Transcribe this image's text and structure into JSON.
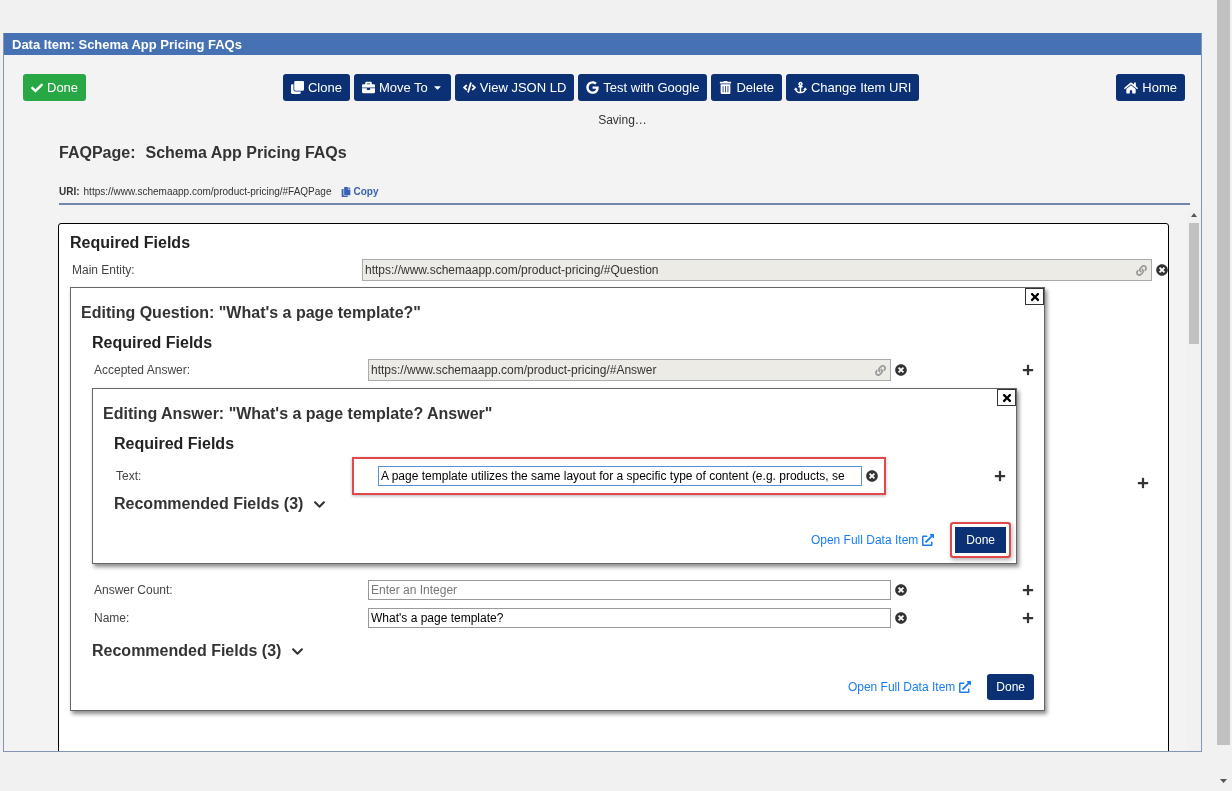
{
  "panel": {
    "title": "Data Item: Schema App Pricing FAQs"
  },
  "toolbar": {
    "done": {
      "label": "Done"
    },
    "actions": [
      {
        "label": "Clone",
        "kind": "clone",
        "dropdown": false
      },
      {
        "label": "Move To",
        "kind": "move",
        "dropdown": true
      },
      {
        "label": "View JSON LD",
        "kind": "code",
        "dropdown": false
      },
      {
        "label": "Test with Google",
        "kind": "google",
        "dropdown": false
      },
      {
        "label": "Delete",
        "kind": "delete",
        "dropdown": false
      },
      {
        "label": "Change Item URI",
        "kind": "anchor",
        "dropdown": false
      }
    ],
    "home": {
      "label": "Home"
    }
  },
  "status": "Saving…",
  "item": {
    "type": "FAQPage:",
    "name": "Schema App Pricing FAQs",
    "uri_label": "URI:",
    "uri": "https://www.schemaapp.com/product-pricing/#FAQPage",
    "copy": "Copy"
  },
  "main_form": {
    "section": "Required Fields",
    "fields": [
      {
        "label": "Main Entity:",
        "value": "https://www.schemaapp.com/product-pricing/#Question",
        "kind": "link"
      }
    ],
    "question_editor": {
      "title": "Editing Question: \"What's a page template?\"",
      "section": "Required Fields",
      "fields": [
        {
          "label": "Accepted Answer:",
          "value": "https://www.schemaapp.com/product-pricing/#Answer",
          "kind": "link"
        }
      ],
      "answer_editor": {
        "title": "Editing Answer: \"What's a page template? Answer\"",
        "section": "Required Fields",
        "fields": [
          {
            "label": "Text:",
            "value": "A page template utilizes the same layout for a specific type of content (e.g. products, se",
            "kind": "text",
            "highlighted": true,
            "focused": true
          }
        ],
        "recommended": "Recommended Fields (3)",
        "open_full": "Open Full Data Item",
        "done": {
          "label": "Done",
          "highlighted": true
        }
      },
      "fields_after": [
        {
          "label": "Answer Count:",
          "placeholder": "Enter an Integer",
          "kind": "text",
          "focused": false
        },
        {
          "label": "Name:",
          "value": "What's a page template?",
          "kind": "text",
          "focused": false
        }
      ],
      "recommended": "Recommended Fields (3)",
      "open_full": "Open Full Data Item",
      "done": {
        "label": "Done",
        "highlighted": false
      }
    }
  }
}
